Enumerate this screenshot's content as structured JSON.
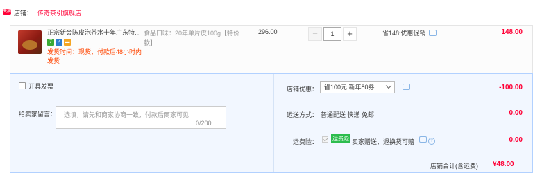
{
  "store": {
    "label": "店铺：",
    "name": "传奇茶引旗舰店",
    "logo_text": "天猫"
  },
  "item": {
    "title": "正宗新会陈皮泡茶水十年广东特...",
    "badges": [
      {
        "icon": "seven-day-return-icon",
        "text": "7",
        "color": "#3aaa35"
      },
      {
        "icon": "guarantee-icon",
        "text": "✓",
        "color": "#2d7dcf"
      },
      {
        "icon": "card-payment-icon",
        "text": "▬",
        "color": "#f5a623"
      }
    ],
    "shipping_note": "发货时间：现货，付款后48小时内发货",
    "sku": "食品口味：20年单片皮100g【特价款】",
    "unit_price": "296.00",
    "quantity": "1",
    "minus": "−",
    "plus": "+",
    "saving": "省148:优惠促销",
    "subtotal": "148.00"
  },
  "options": {
    "invoice_label": "开具发票",
    "message_label": "给卖家留言：",
    "message_placeholder": "选填，请先和商家协商一致，付款后商家可见",
    "message_count": "0/200",
    "store_promo_label": "店铺优惠：",
    "store_promo_value": "省100元:新年80券",
    "store_promo_amount": "-100.00",
    "delivery_label": "运送方式：",
    "delivery_value": "普通配送 快递 免邮",
    "delivery_amount": "0.00",
    "insurance_label": "运费险：",
    "insurance_badge": "运费险",
    "insurance_text": "卖家赠送，退换货可赔",
    "insurance_help": "?",
    "insurance_amount": "0.00"
  },
  "footer": {
    "total_label": "店铺合计(含运费)",
    "total_value": "¥48.00"
  },
  "colors": {
    "accent": "#ff0036",
    "orange": "#ff4400",
    "panel": "#f2f7ff"
  }
}
